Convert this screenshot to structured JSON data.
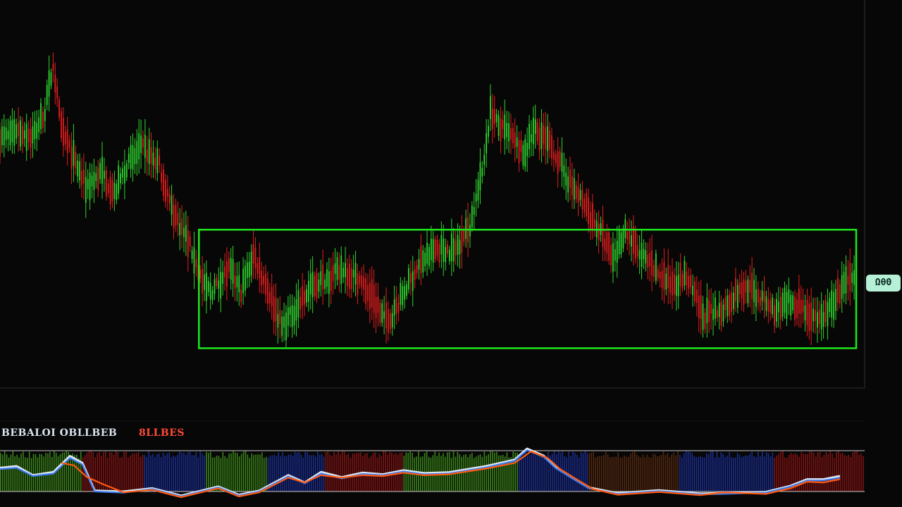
{
  "theme": {
    "background": "#070707",
    "bull": "#2fd52f",
    "bear": "#e21e1e",
    "box": "#1ee61e",
    "line_white": "#dfe8f2",
    "line_blue": "#3f7ef0",
    "line_orange": "#ff5a10",
    "hist_green": "#3d8a1a",
    "hist_red": "#8a1414",
    "hist_blue": "#1c2f9a"
  },
  "price_tag": {
    "text": "ΩθΘ"
  },
  "oscillator": {
    "label_primary": "BEBALOI OBLLBEB",
    "label_secondary": "8LLBES"
  },
  "chart_data": [
    {
      "type": "candlestick",
      "title": "",
      "xlabel": "",
      "ylabel": "",
      "ylim": [
        0,
        100
      ],
      "grid": false,
      "trend_points": [
        [
          0,
          63
        ],
        [
          8,
          66
        ],
        [
          16,
          64
        ],
        [
          22,
          71
        ],
        [
          26,
          84
        ],
        [
          30,
          66
        ],
        [
          36,
          58
        ],
        [
          42,
          50
        ],
        [
          50,
          54
        ],
        [
          56,
          48
        ],
        [
          62,
          56
        ],
        [
          70,
          61
        ],
        [
          78,
          56
        ],
        [
          84,
          44
        ],
        [
          92,
          35
        ],
        [
          100,
          22
        ],
        [
          104,
          21
        ],
        [
          112,
          27
        ],
        [
          118,
          21
        ],
        [
          124,
          31
        ],
        [
          130,
          23
        ],
        [
          138,
          11
        ],
        [
          146,
          17
        ],
        [
          154,
          23
        ],
        [
          162,
          25
        ],
        [
          168,
          27
        ],
        [
          176,
          24
        ],
        [
          182,
          19
        ],
        [
          190,
          12
        ],
        [
          198,
          21
        ],
        [
          206,
          29
        ],
        [
          214,
          33
        ],
        [
          222,
          32
        ],
        [
          230,
          39
        ],
        [
          236,
          54
        ],
        [
          240,
          71
        ],
        [
          244,
          67
        ],
        [
          250,
          64
        ],
        [
          256,
          59
        ],
        [
          262,
          66
        ],
        [
          270,
          61
        ],
        [
          278,
          52
        ],
        [
          286,
          45
        ],
        [
          294,
          37
        ],
        [
          300,
          30
        ],
        [
          306,
          38
        ],
        [
          312,
          32
        ],
        [
          320,
          27
        ],
        [
          328,
          23
        ],
        [
          336,
          25
        ],
        [
          344,
          14
        ],
        [
          352,
          15
        ],
        [
          360,
          20
        ],
        [
          366,
          22
        ],
        [
          372,
          19
        ],
        [
          380,
          15
        ],
        [
          386,
          18
        ],
        [
          392,
          17
        ],
        [
          400,
          12
        ],
        [
          406,
          16
        ],
        [
          412,
          22
        ],
        [
          419,
          25
        ]
      ],
      "range_box": {
        "x_start": 97,
        "x_end": 419,
        "y_low": 5,
        "y_high": 38
      }
    },
    {
      "type": "line",
      "title": "",
      "xlabel": "",
      "ylabel": "",
      "ylim": [
        0,
        100
      ],
      "series": [
        {
          "color": "#dfe8f2",
          "points": [
            [
              0,
              58
            ],
            [
              8,
              62
            ],
            [
              16,
              40
            ],
            [
              26,
              48
            ],
            [
              34,
              87
            ],
            [
              40,
              70
            ],
            [
              46,
              2
            ],
            [
              60,
              0
            ],
            [
              74,
              8
            ],
            [
              88,
              -10
            ],
            [
              106,
              12
            ],
            [
              116,
              -8
            ],
            [
              126,
              2
            ],
            [
              140,
              40
            ],
            [
              148,
              22
            ],
            [
              156,
              48
            ],
            [
              166,
              35
            ],
            [
              176,
              46
            ],
            [
              186,
              42
            ],
            [
              196,
              52
            ],
            [
              206,
              45
            ],
            [
              218,
              47
            ],
            [
              236,
              62
            ],
            [
              250,
              78
            ],
            [
              256,
              105
            ],
            [
              264,
              88
            ],
            [
              270,
              60
            ],
            [
              278,
              35
            ],
            [
              286,
              10
            ],
            [
              300,
              -4
            ],
            [
              320,
              3
            ],
            [
              340,
              -5
            ],
            [
              350,
              -4
            ],
            [
              372,
              -1
            ],
            [
              384,
              14
            ],
            [
              392,
              30
            ],
            [
              400,
              30
            ],
            [
              408,
              38
            ]
          ]
        },
        {
          "color": "#3f7ef0",
          "points": [
            [
              0,
              55
            ],
            [
              8,
              58
            ],
            [
              16,
              38
            ],
            [
              26,
              44
            ],
            [
              34,
              82
            ],
            [
              40,
              66
            ],
            [
              46,
              0
            ],
            [
              60,
              -3
            ],
            [
              74,
              6
            ],
            [
              88,
              -12
            ],
            [
              106,
              10
            ],
            [
              116,
              -10
            ],
            [
              126,
              0
            ],
            [
              140,
              37
            ],
            [
              148,
              20
            ],
            [
              156,
              44
            ],
            [
              166,
              32
            ],
            [
              176,
              43
            ],
            [
              186,
              40
            ],
            [
              196,
              49
            ],
            [
              206,
              42
            ],
            [
              218,
              44
            ],
            [
              236,
              59
            ],
            [
              250,
              75
            ],
            [
              256,
              101
            ],
            [
              264,
              85
            ],
            [
              270,
              57
            ],
            [
              278,
              32
            ],
            [
              286,
              8
            ],
            [
              300,
              -6
            ],
            [
              320,
              1
            ],
            [
              340,
              -7
            ],
            [
              350,
              -6
            ],
            [
              372,
              -3
            ],
            [
              384,
              12
            ],
            [
              392,
              27
            ],
            [
              400,
              27
            ],
            [
              408,
              34
            ]
          ]
        },
        {
          "color": "#ff5a10",
          "points": [
            [
              30,
              70
            ],
            [
              36,
              64
            ],
            [
              42,
              36
            ],
            [
              50,
              18
            ],
            [
              60,
              -2
            ],
            [
              74,
              4
            ],
            [
              88,
              -14
            ],
            [
              106,
              8
            ],
            [
              116,
              -12
            ],
            [
              126,
              -2
            ],
            [
              140,
              34
            ],
            [
              148,
              22
            ],
            [
              156,
              40
            ],
            [
              166,
              34
            ],
            [
              176,
              40
            ],
            [
              186,
              38
            ],
            [
              196,
              46
            ],
            [
              206,
              40
            ],
            [
              218,
              42
            ],
            [
              236,
              56
            ],
            [
              250,
              70
            ],
            [
              258,
              98
            ],
            [
              266,
              82
            ],
            [
              272,
              55
            ],
            [
              280,
              30
            ],
            [
              288,
              6
            ],
            [
              300,
              -8
            ],
            [
              320,
              -1
            ],
            [
              340,
              -9
            ],
            [
              352,
              -2
            ],
            [
              372,
              -6
            ],
            [
              384,
              8
            ],
            [
              392,
              24
            ],
            [
              400,
              22
            ],
            [
              408,
              30
            ]
          ]
        }
      ],
      "histogram_bands": [
        {
          "x_start": 0,
          "x_end": 40,
          "color": "#3d8a1a"
        },
        {
          "x_start": 40,
          "x_end": 70,
          "color": "#8a1414"
        },
        {
          "x_start": 70,
          "x_end": 100,
          "color": "#1c2f9a"
        },
        {
          "x_start": 100,
          "x_end": 130,
          "color": "#3d8a1a"
        },
        {
          "x_start": 130,
          "x_end": 158,
          "color": "#1c2f9a"
        },
        {
          "x_start": 158,
          "x_end": 196,
          "color": "#8a1414"
        },
        {
          "x_start": 196,
          "x_end": 232,
          "color": "#3d8a1a"
        },
        {
          "x_start": 232,
          "x_end": 252,
          "color": "#3d8a1a"
        },
        {
          "x_start": 252,
          "x_end": 286,
          "color": "#1c2f9a"
        },
        {
          "x_start": 286,
          "x_end": 330,
          "color": "#5a2a10"
        },
        {
          "x_start": 330,
          "x_end": 376,
          "color": "#1c2f9a"
        },
        {
          "x_start": 376,
          "x_end": 390,
          "color": "#8a1414"
        },
        {
          "x_start": 390,
          "x_end": 420,
          "color": "#8a1414"
        }
      ]
    }
  ]
}
